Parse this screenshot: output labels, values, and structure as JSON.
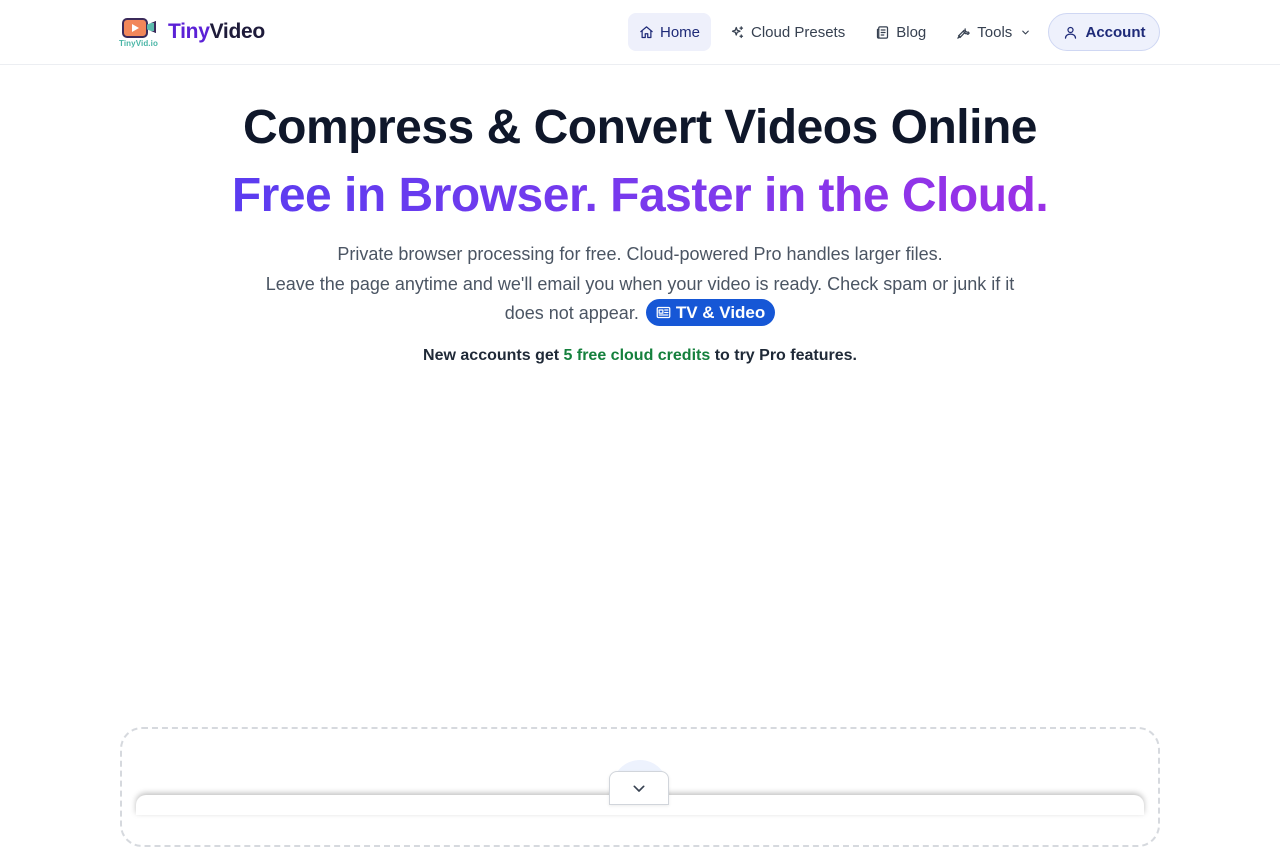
{
  "brand": {
    "name_part1": "Tiny",
    "name_part2": "Video",
    "logo_caption": "TinyVid.io",
    "logo_icon": "video-camera-logo-icon"
  },
  "nav": {
    "items": [
      {
        "label": "Home",
        "icon": "home-icon",
        "active": true
      },
      {
        "label": "Cloud Presets",
        "icon": "sparkles-icon",
        "active": false
      },
      {
        "label": "Blog",
        "icon": "newspaper-icon",
        "active": false
      },
      {
        "label": "Tools",
        "icon": "wrench-icon",
        "active": false,
        "dropdown": true
      }
    ],
    "account_label": "Account",
    "account_icon": "user-icon"
  },
  "hero": {
    "title": "Compress & Convert Videos Online",
    "subtitle": "Free in Browser. Faster in the Cloud.",
    "desc_line1": "Private browser processing for free. Cloud-powered Pro handles larger files.",
    "desc_line2": "Leave the page anytime and we'll email you when your video is ready. Check spam or junk if it does not appear.",
    "badge_label": "TV & Video",
    "badge_icon": "news-card-icon",
    "credits_prefix": "New accounts get ",
    "credits_highlight": "5 free cloud credits",
    "credits_suffix": " to try Pro features."
  },
  "colors": {
    "brand_purple": "#5b21d6",
    "gradient_start": "#5b3cf0",
    "gradient_end": "#9b30e6",
    "badge_blue": "#1657d6",
    "credits_green": "#15803d",
    "nav_active_bg": "#eef0fb"
  },
  "expand": {
    "icon": "chevron-down-icon"
  }
}
